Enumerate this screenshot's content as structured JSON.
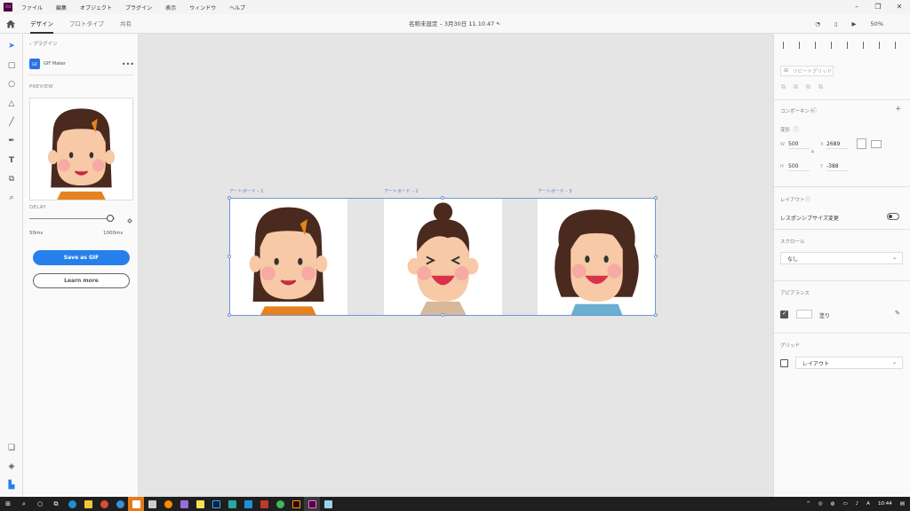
{
  "menu": {
    "app_icon": "Xd",
    "items": [
      "ファイル",
      "編集",
      "オブジェクト",
      "プラグイン",
      "表示",
      "ウィンドウ",
      "ヘルプ"
    ]
  },
  "header": {
    "tabs": [
      "デザイン",
      "プロトタイプ",
      "共有"
    ],
    "doc_title": "名称未設定 – 3月30日 11.10.47 *",
    "zoom": "50%"
  },
  "plugin_panel": {
    "back_label": "プラグイン",
    "plugin_name": "GIF Maker",
    "plugin_icon_text": "GIF",
    "more": "•••",
    "preview_label": "PREVIEW",
    "delay_label": "DELAY",
    "delay_min": "50ms",
    "delay_max": "1000ms",
    "delay_value_fraction": 0.95,
    "primary_button": "Save as GIF",
    "secondary_button": "Learn more"
  },
  "artboards": [
    {
      "label": "アートボード – 1"
    },
    {
      "label": "アートボード – 2"
    },
    {
      "label": "アートボード – 3"
    }
  ],
  "right_panel": {
    "repeat_grid": "リピートグリッド",
    "component": "コンポーネント",
    "transform": "変形",
    "w_label": "W",
    "w_value": "500",
    "x_label": "X",
    "x_value": "2689",
    "h_label": "H",
    "h_value": "500",
    "y_label": "Y",
    "y_value": "-388",
    "layout": "レイアウト",
    "responsive": "レスポンシブサイズ変更",
    "scroll": "スクロール",
    "scroll_value": "なし",
    "appearance": "アピアランス",
    "fill": "塗り",
    "grid": "グリッド",
    "grid_value": "レイアウト"
  },
  "taskbar": {
    "time": "10:44",
    "ime": "A"
  }
}
